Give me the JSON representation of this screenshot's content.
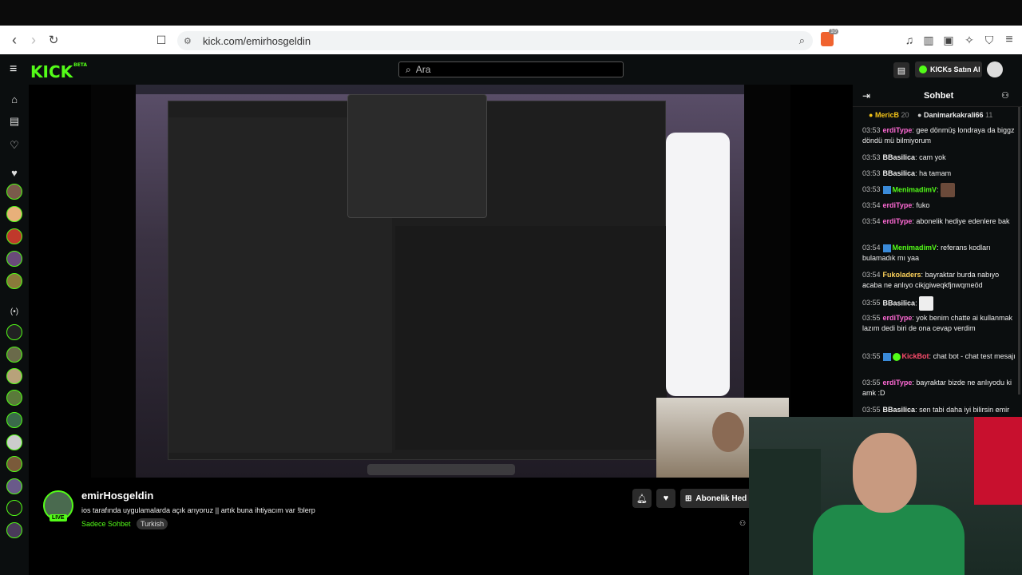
{
  "browser": {
    "url": "kick.com/emirhosgeldin",
    "extension_badge": "10"
  },
  "site": {
    "logo": "KICK",
    "logo_suffix": "BETA",
    "search_placeholder": "Ara",
    "buy_kicks_label": "KICKs Satın Al"
  },
  "stream": {
    "streamer": "emirHosgeldin",
    "live_label": "LIVE",
    "title": "ios tarafında uygulamalarda açık arıyoruz || artık buna ihtiyacım var !blerp",
    "category": "Sadece Sohbet",
    "tag": "Turkish",
    "subscribe_label": "Abonelik Hed"
  },
  "chat": {
    "title": "Sohbet",
    "gifters": [
      {
        "name": "MericB",
        "count": "20"
      },
      {
        "name": "Danimarkakrali66",
        "count": "11"
      }
    ],
    "messages": [
      {
        "time": "03:53",
        "user": "erdiType",
        "color": "#ff6ad5",
        "text": "gee dönmüş londraya da biggz döndü mü bilmiyorum"
      },
      {
        "time": "03:53",
        "user": "BBasilica",
        "color": "#ffffff",
        "text": "cam yok"
      },
      {
        "time": "03:53",
        "user": "BBasilica",
        "color": "#ffffff",
        "text": "ha tamam"
      },
      {
        "time": "03:53",
        "user": "MenimadimV",
        "color": "#53fc18",
        "text": ""
      },
      {
        "time": "03:54",
        "user": "erdiType",
        "color": "#ff6ad5",
        "text": "fuko"
      },
      {
        "time": "03:54",
        "user": "erdiType",
        "color": "#ff6ad5",
        "text": "abonelik hediye edenlere bak"
      },
      {
        "time": "03:54",
        "user": "MenimadimV",
        "color": "#53fc18",
        "text": "referans kodları bulamadık mı yaa"
      },
      {
        "time": "03:54",
        "user": "Fukoladers",
        "color": "#ffd35c",
        "text": "bayraktar burda nabıyo acaba ne anlıyo cikjgiweqkfjnwqmeöd"
      },
      {
        "time": "03:55",
        "user": "BBasilica",
        "color": "#ffffff",
        "text": ""
      },
      {
        "time": "03:55",
        "user": "erdiType",
        "color": "#ff6ad5",
        "text": "yok benim chatte ai kullanmak lazım dedi biri de ona cevap verdim"
      },
      {
        "time": "03:55",
        "user": "KickBot",
        "color": "#ff4d6d",
        "text": "chat bot - chat test mesajı"
      },
      {
        "time": "03:55",
        "user": "erdiType",
        "color": "#ff6ad5",
        "text": "bayraktar bizde ne anlıyodu ki amk :D"
      },
      {
        "time": "03:55",
        "user": "BBasilica",
        "color": "#ffffff",
        "text": "sen tabi daha iyi bilirsin emir"
      }
    ]
  },
  "colors": {
    "brand": "#53fc18",
    "bg": "#0b0e0f"
  }
}
